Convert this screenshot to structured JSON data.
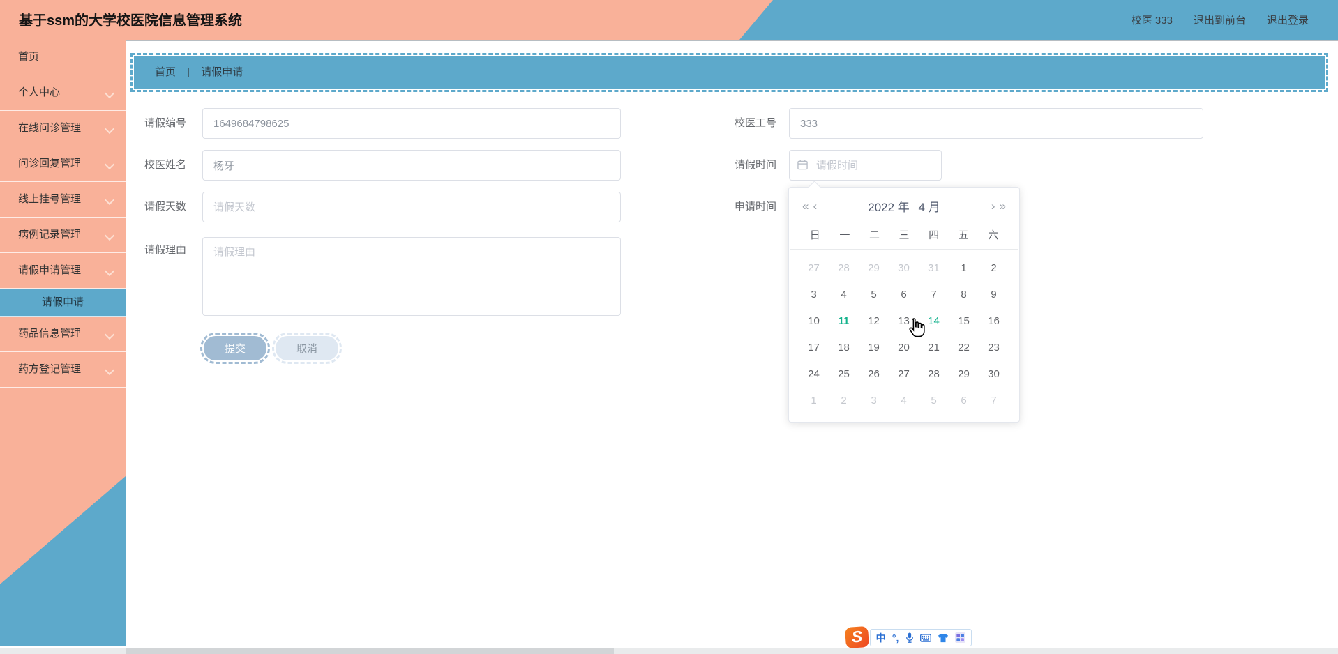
{
  "colors": {
    "salmon": "#f9b199",
    "blue": "#5da9cb",
    "calendar_green": "#13b28c",
    "button_primary": "#a1bbd3",
    "button_cancel": "#dfe8f2"
  },
  "header": {
    "title": "基于ssm的大学校医院信息管理系统",
    "user_label": "校医 333",
    "logout_front": "退出到前台",
    "logout": "退出登录"
  },
  "sidebar": {
    "items": [
      {
        "label": "首页"
      },
      {
        "label": "个人中心"
      },
      {
        "label": "在线问诊管理"
      },
      {
        "label": "问诊回复管理"
      },
      {
        "label": "线上挂号管理"
      },
      {
        "label": "病例记录管理"
      },
      {
        "label": "请假申请管理"
      },
      {
        "label": "药品信息管理"
      },
      {
        "label": "药方登记管理"
      }
    ],
    "active_subitem": "请假申请"
  },
  "breadcrumb": {
    "home": "首页",
    "separator": "|",
    "current": "请假申请"
  },
  "form": {
    "leave_id": {
      "label": "请假编号",
      "value": "1649684798625"
    },
    "doctor_name": {
      "label": "校医姓名",
      "value": "杨牙"
    },
    "leave_days": {
      "label": "请假天数",
      "placeholder": "请假天数"
    },
    "leave_reason": {
      "label": "请假理由",
      "placeholder": "请假理由"
    },
    "doctor_no": {
      "label": "校医工号",
      "value": "333"
    },
    "leave_time": {
      "label": "请假时间",
      "placeholder": "请假时间"
    },
    "apply_time": {
      "label": "申请时间"
    },
    "submit": "提交",
    "cancel": "取消"
  },
  "datepicker": {
    "prev_year": "«",
    "prev_month": "‹",
    "next_month": "›",
    "next_year": "»",
    "year": "2022 年",
    "month": "4 月",
    "weekdays": [
      "日",
      "一",
      "二",
      "三",
      "四",
      "五",
      "六"
    ],
    "rows": [
      [
        {
          "d": "27",
          "s": "muted"
        },
        {
          "d": "28",
          "s": "muted"
        },
        {
          "d": "29",
          "s": "muted"
        },
        {
          "d": "30",
          "s": "muted"
        },
        {
          "d": "31",
          "s": "muted"
        },
        {
          "d": "1",
          "s": ""
        },
        {
          "d": "2",
          "s": ""
        }
      ],
      [
        {
          "d": "3",
          "s": ""
        },
        {
          "d": "4",
          "s": ""
        },
        {
          "d": "5",
          "s": ""
        },
        {
          "d": "6",
          "s": ""
        },
        {
          "d": "7",
          "s": ""
        },
        {
          "d": "8",
          "s": ""
        },
        {
          "d": "9",
          "s": ""
        }
      ],
      [
        {
          "d": "10",
          "s": ""
        },
        {
          "d": "11",
          "s": "today"
        },
        {
          "d": "12",
          "s": ""
        },
        {
          "d": "13",
          "s": ""
        },
        {
          "d": "14",
          "s": "hover"
        },
        {
          "d": "15",
          "s": ""
        },
        {
          "d": "16",
          "s": ""
        }
      ],
      [
        {
          "d": "17",
          "s": ""
        },
        {
          "d": "18",
          "s": ""
        },
        {
          "d": "19",
          "s": ""
        },
        {
          "d": "20",
          "s": ""
        },
        {
          "d": "21",
          "s": ""
        },
        {
          "d": "22",
          "s": ""
        },
        {
          "d": "23",
          "s": ""
        }
      ],
      [
        {
          "d": "24",
          "s": ""
        },
        {
          "d": "25",
          "s": ""
        },
        {
          "d": "26",
          "s": ""
        },
        {
          "d": "27",
          "s": ""
        },
        {
          "d": "28",
          "s": ""
        },
        {
          "d": "29",
          "s": ""
        },
        {
          "d": "30",
          "s": ""
        }
      ],
      [
        {
          "d": "1",
          "s": "muted"
        },
        {
          "d": "2",
          "s": "muted"
        },
        {
          "d": "3",
          "s": "muted"
        },
        {
          "d": "4",
          "s": "muted"
        },
        {
          "d": "5",
          "s": "muted"
        },
        {
          "d": "6",
          "s": "muted"
        },
        {
          "d": "7",
          "s": "muted"
        }
      ]
    ]
  },
  "ime": {
    "logo": "S",
    "chinese_mode": "中",
    "punctuation": "°,",
    "icons": [
      "microphone-icon",
      "keyboard-icon",
      "skin-icon",
      "toolbox-icon"
    ]
  }
}
